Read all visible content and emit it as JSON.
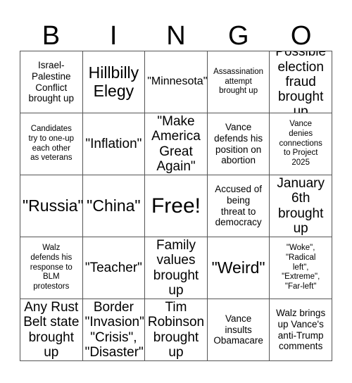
{
  "card": {
    "title": "BINGO",
    "header_letters": [
      "B",
      "I",
      "N",
      "G",
      "O"
    ],
    "rows": [
      [
        {
          "text": "Israel-\nPalestine\nConflict\nbrought up",
          "size": "sm"
        },
        {
          "text": "Hillbilly\nElegy",
          "size": "xl"
        },
        {
          "text": "\"Minnesota\"",
          "size": "md"
        },
        {
          "text": "Assassination\nattempt\nbrought up",
          "size": "xs"
        },
        {
          "text": "Possible\nelection\nfraud\nbrought up",
          "size": "lg"
        }
      ],
      [
        {
          "text": "Candidates\ntry to one-up\neach other\nas veterans",
          "size": "xs"
        },
        {
          "text": "\"Inflation\"",
          "size": "lg"
        },
        {
          "text": "\"Make\nAmerica\nGreat\nAgain\"",
          "size": "lg"
        },
        {
          "text": "Vance\ndefends his\nposition on\nabortion",
          "size": "sm"
        },
        {
          "text": "Vance\ndenies\nconnections\nto Project\n2025",
          "size": "xs"
        }
      ],
      [
        {
          "text": "\"Russia\"",
          "size": "xl"
        },
        {
          "text": "\"China\"",
          "size": "xl"
        },
        {
          "text": "Free!",
          "size": "xxl"
        },
        {
          "text": "Accused of\nbeing\nthreat to\ndemocracy",
          "size": "sm"
        },
        {
          "text": "January\n6th\nbrought\nup",
          "size": "lg"
        }
      ],
      [
        {
          "text": "Walz\ndefends his\nresponse to\nBLM\nprotestors",
          "size": "xs"
        },
        {
          "text": "\"Teacher\"",
          "size": "lg"
        },
        {
          "text": "Family\nvalues\nbrought\nup",
          "size": "lg"
        },
        {
          "text": "\"Weird\"",
          "size": "xl"
        },
        {
          "text": "\"Woke\",\n\"Radical\nleft\",\n\"Extreme\",\n\"Far-left\"",
          "size": "xs"
        }
      ],
      [
        {
          "text": "Any Rust\nBelt state\nbrought\nup",
          "size": "lg"
        },
        {
          "text": "Border\n\"Invasion\",\n\"Crisis\",\n\"Disaster\"",
          "size": "lg"
        },
        {
          "text": "Tim\nRobinson\nbrought\nup",
          "size": "lg"
        },
        {
          "text": "Vance\ninsults\nObamacare",
          "size": "sm"
        },
        {
          "text": "Walz brings\nup Vance's\nanti-Trump\ncomments",
          "size": "sm"
        }
      ]
    ]
  },
  "colors": {
    "background": "#ffffff",
    "text": "#000000",
    "grid_line": "#555555"
  }
}
